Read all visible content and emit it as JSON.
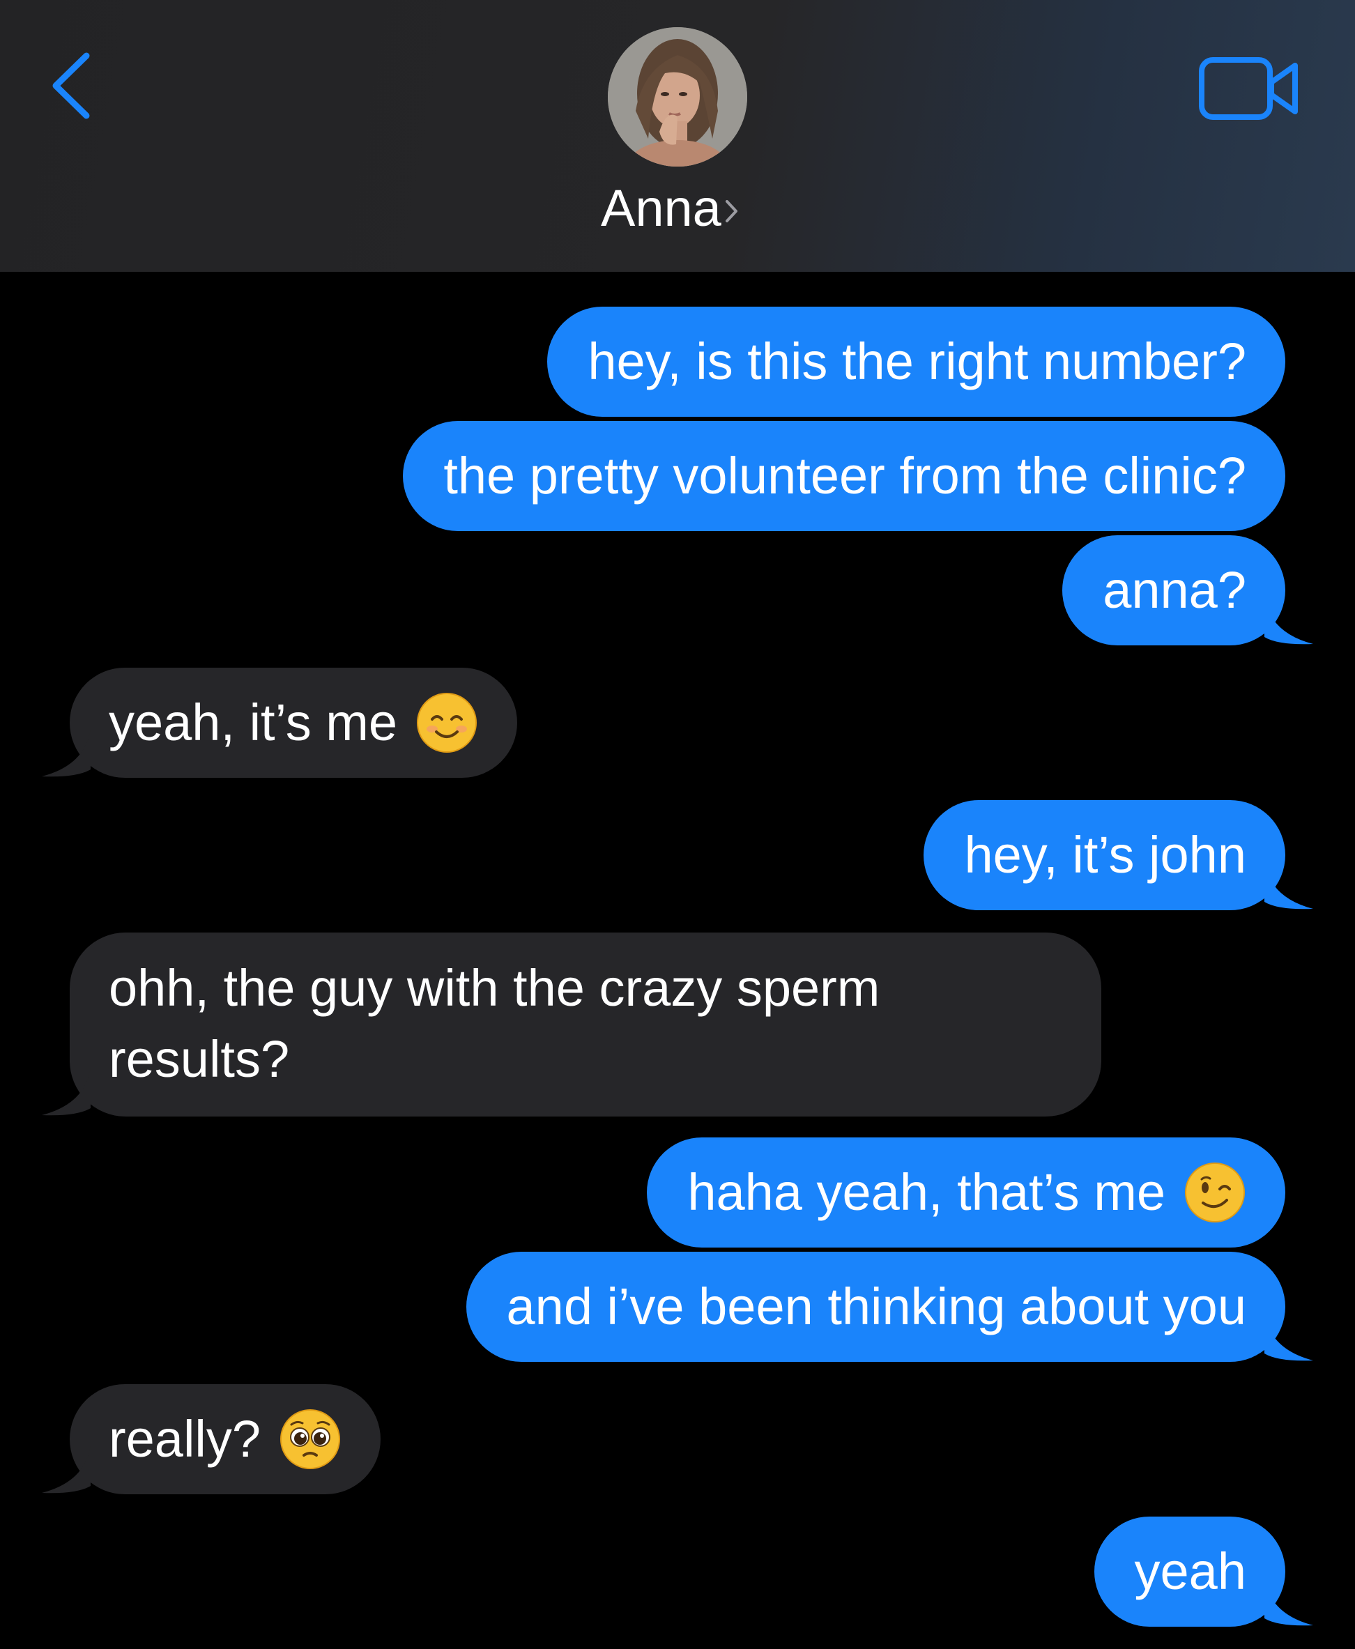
{
  "header": {
    "contact_name": "Anna",
    "chevron": "›",
    "back_icon": "chevron-left-icon",
    "video_icon": "video-camera-icon",
    "accent_color": "#1a84fb"
  },
  "messages": [
    {
      "from": "me",
      "text": "hey, is this the right number?"
    },
    {
      "from": "me",
      "text": "the pretty volunteer from the clinic?"
    },
    {
      "from": "me",
      "text": "anna?"
    },
    {
      "from": "them",
      "text": "yeah, it’s me",
      "emoji": "smiling-face-with-smiling-eyes"
    },
    {
      "from": "me",
      "text": "hey, it’s john"
    },
    {
      "from": "them",
      "line1": "ohh, the guy with the crazy sperm",
      "line2": "results?"
    },
    {
      "from": "me",
      "text": "haha yeah, that’s me",
      "emoji": "winking-face"
    },
    {
      "from": "me",
      "text": "and i’ve been thinking about you"
    },
    {
      "from": "them",
      "text": "really?",
      "emoji": "pleading-face"
    },
    {
      "from": "me",
      "text": "yeah"
    }
  ],
  "colors": {
    "sent_bubble": "#1a84fb",
    "received_bubble": "#262629",
    "background": "#000000"
  }
}
